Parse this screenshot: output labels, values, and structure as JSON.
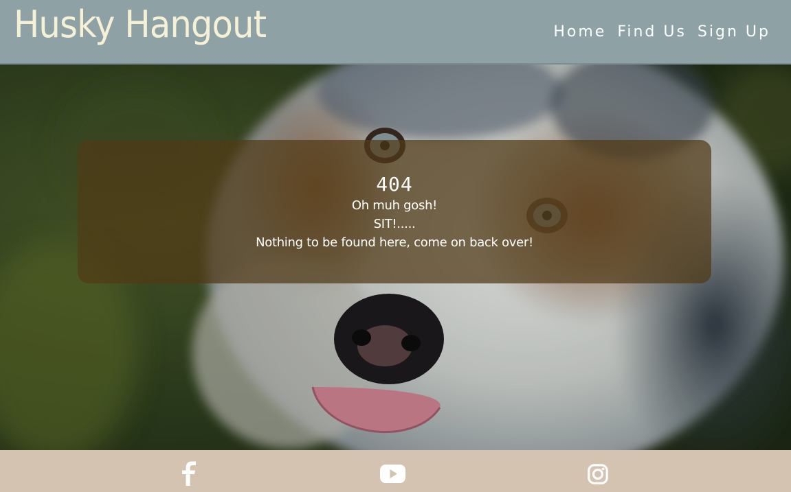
{
  "header": {
    "site_title": "Husky Hangout",
    "nav": [
      {
        "label": "Home"
      },
      {
        "label": "Find Us"
      },
      {
        "label": "Sign Up"
      }
    ]
  },
  "error_panel": {
    "code": "404",
    "line1": "Oh muh gosh!",
    "line2": "SIT!.....",
    "line3": "Nothing to be found here, come on back over!"
  },
  "footer": {
    "social_icons": [
      "facebook-icon",
      "youtube-icon",
      "instagram-icon"
    ]
  },
  "colors": {
    "header_bg": "#8ea2a6",
    "title_color": "#f6f1d6",
    "footer_bg": "#d4c3b0",
    "panel_bg": "#503a16"
  }
}
